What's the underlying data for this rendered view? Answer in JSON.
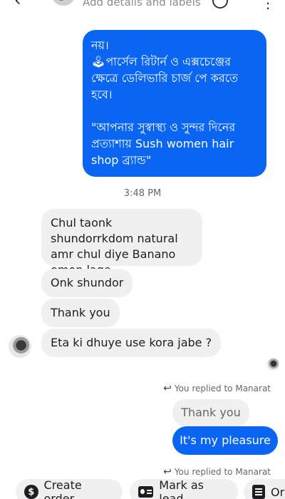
{
  "header": {
    "subtitle": "Add details and labels"
  },
  "messages": {
    "outgoing_long": {
      "line1": "নয়।",
      "line2_icon": "🕹",
      "line2": "পার্সেল রিটার্ন ও এক্সচেঞ্জের ক্ষেত্রে ডেলিভারি চার্জ পে করতে হবে।",
      "line3": "\"আপনার সুস্বাস্থ্য ও সুন্দর দিনের প্রত্যাশায় Sush women hair shop ব্র্যান্ড\""
    },
    "timestamp": "3:48 PM",
    "incoming": [
      "Chul taonk shundorrkdom natural amr chul diye Banano emon lage",
      "Onk shundor",
      "Thank you",
      "Eta ki dhuye use kora jabe ?"
    ],
    "replied_label_1": "You replied to Manarat",
    "quoted": "Thank you",
    "outgoing_reply": "It's my pleasure",
    "replied_label_2": "You replied to Manarat"
  },
  "actions": {
    "create_order": "Create order",
    "mark_as_lead": "Mark as lead",
    "order_partial": "Or"
  },
  "colors": {
    "outgoing_bubble": "#0a66f2",
    "incoming_bubble": "#f0f0f0"
  },
  "icons": [
    "back-arrow-icon",
    "contact-avatar",
    "info-icon",
    "more-icon",
    "reply-arrow-icon",
    "dollar-icon",
    "lead-card-icon",
    "order-list-icon"
  ]
}
